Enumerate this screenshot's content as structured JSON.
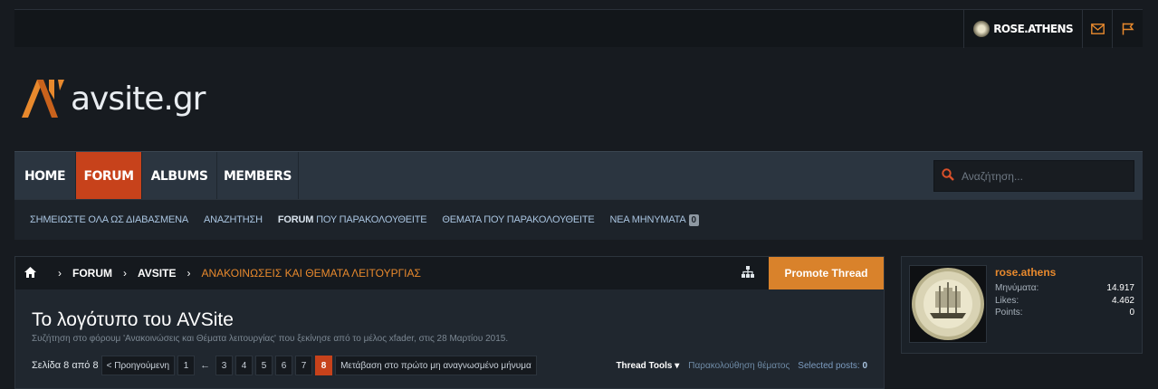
{
  "topbar": {
    "username": "ROSE.ATHENS",
    "icons": [
      "mail-icon",
      "flag-icon"
    ]
  },
  "logo": {
    "text": "avsite.gr"
  },
  "nav": {
    "tabs": [
      {
        "label": "HOME",
        "active": false
      },
      {
        "label": "FORUM",
        "active": true
      },
      {
        "label": "ALBUMS",
        "active": false
      },
      {
        "label": "MEMBERS",
        "active": false
      }
    ],
    "search_placeholder": "Αναζήτηση..."
  },
  "subnav": {
    "mark_read": "ΣΗΜΕΙΩΣΤΕ ΟΛΑ ΩΣ ΔΙΑΒΑΣΜΕΝΑ",
    "search": "ΑΝΑΖΗΤΗΣΗ",
    "forum_watched_bold": "FORUM",
    "forum_watched_rest": " ΠΟΥ ΠΑΡΑΚΟΛΟΥΘΕΙΤΕ",
    "threads_watched": "ΘΕΜΑΤΑ ΠΟΥ ΠΑΡΑΚΟΛΟΥΘΕΙΤΕ",
    "new_posts": "ΝΕΑ ΜΗΝΥΜΑΤΑ",
    "new_posts_count": "0"
  },
  "breadcrumb": {
    "items": [
      "FORUM",
      "AVSITE",
      "ΑΝΑΚΟΙΝΩΣΕΙΣ ΚΑΙ ΘΕΜΑΤΑ ΛΕΙΤΟΥΡΓΙΑΣ"
    ]
  },
  "thread": {
    "promote_label": "Promote Thread",
    "title": "Το λογότυπο του AVSite",
    "description": "Συζήτηση στο φόρουμ 'Ανακοινώσεις και Θέματα λειτουργίας' που ξεκίνησε από το μέλος xfader, στις 28 Μαρτίου 2015."
  },
  "pager": {
    "label": "Σελίδα 8 από 8",
    "prev": "< Προηγούμενη",
    "first": "1",
    "gap": "←",
    "pages": [
      "3",
      "4",
      "5",
      "6",
      "7"
    ],
    "current": "8",
    "goto_unread": "Μετάβαση στο πρώτο μη αναγνωσμένο μήνυμα"
  },
  "tools": {
    "thread_tools": "Thread Tools ▾",
    "watch": "Παρακολούθηση θέματος",
    "selected_label": "Selected posts:",
    "selected_count": "0"
  },
  "user_card": {
    "name": "rose.athens",
    "stats": [
      {
        "label": "Μηνύματα:",
        "value": "14.917"
      },
      {
        "label": "Likes:",
        "value": "4.462"
      },
      {
        "label": "Points:",
        "value": "0"
      }
    ]
  },
  "colors": {
    "accent_orange": "#e8892d",
    "active_tab": "#c7421b",
    "promote": "#d9822b"
  }
}
